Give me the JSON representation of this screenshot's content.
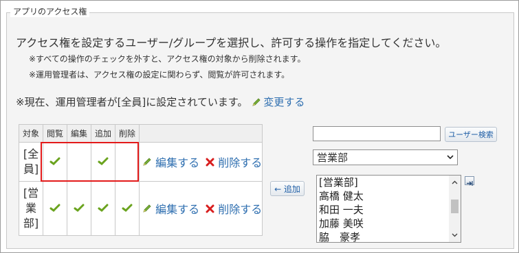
{
  "panel": {
    "title": "アプリのアクセス権"
  },
  "description": "アクセス権を設定するユーザー/グループを選択し、許可する操作を指定してください。",
  "notes": [
    "※すべての操作のチェックを外すと、アクセス権の対象から削除されます。",
    "※運用管理者は、アクセス権の設定に関わらず、閲覧が許可されます。"
  ],
  "current_admin": {
    "text": "※現在、運用管理者が[全員]に設定されています。",
    "change_link": "変更する"
  },
  "table": {
    "headers": [
      "対象",
      "閲覧",
      "編集",
      "追加",
      "削除"
    ],
    "rows": [
      {
        "target": "[全員]",
        "view": true,
        "edit": false,
        "add": true,
        "delete": false,
        "edit_link": "編集する",
        "delete_link": "削除する"
      },
      {
        "target": "[営業部]",
        "view": true,
        "edit": true,
        "add": true,
        "delete": true,
        "edit_link": "編集する",
        "delete_link": "削除する"
      }
    ]
  },
  "add_button": "← 追加",
  "search": {
    "value": "",
    "button_label": "ユーザー検索"
  },
  "department_select": {
    "selected": "営業部"
  },
  "user_list": [
    "[営業部]",
    "高橋 健太",
    "和田 一夫",
    "加藤 美咲",
    "脇　豪孝"
  ],
  "colors": {
    "link": "#2f6fb0",
    "check": "#6aa31e",
    "delete_x": "#d81e1e",
    "highlight_box": "#e31919"
  }
}
